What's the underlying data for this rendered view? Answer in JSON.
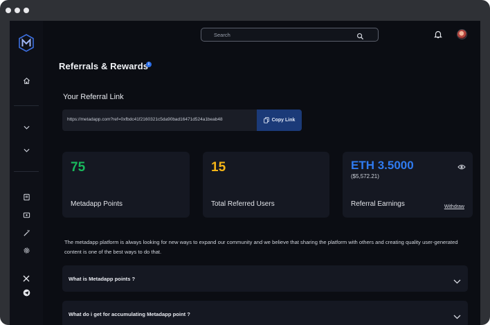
{
  "search": {
    "placeholder": "Search"
  },
  "page": {
    "title": "Referrals & Rewards",
    "info_icon": "info-icon"
  },
  "referral": {
    "label": "Your Referral Link",
    "link": "https://metadapp.com?ref=0xfbdc41f2160321c5da90bad16471d524a1beab48",
    "copy_label": "Copy Link"
  },
  "cards": [
    {
      "value": "75",
      "label": "Metadapp Points",
      "color": "#19b85c"
    },
    {
      "value": "15",
      "label": "Total Referred Users",
      "color": "#f5b517"
    },
    {
      "value": "ETH 3.5000",
      "sub": "($5,572.21)",
      "label": "Referral Earnings",
      "action": "Withdraw",
      "color": "#2f7bf0"
    }
  ],
  "description": "The metadapp platform is always looking for new ways to expand our community and we believe that  sharing the platform with others and creating quality user-generated content is one of the best ways to do that.",
  "faq": [
    {
      "question": "What is Metadapp points ?"
    },
    {
      "question": "What do i get for accumulating Metadapp point ?"
    }
  ],
  "sidebar": {
    "icons": [
      "logo-icon",
      "home-icon",
      "chevron-down-icon",
      "chevron-down-icon",
      "document-icon",
      "wallet-icon",
      "magic-wand-icon",
      "settings-icon",
      "x-icon",
      "telegram-icon"
    ]
  }
}
